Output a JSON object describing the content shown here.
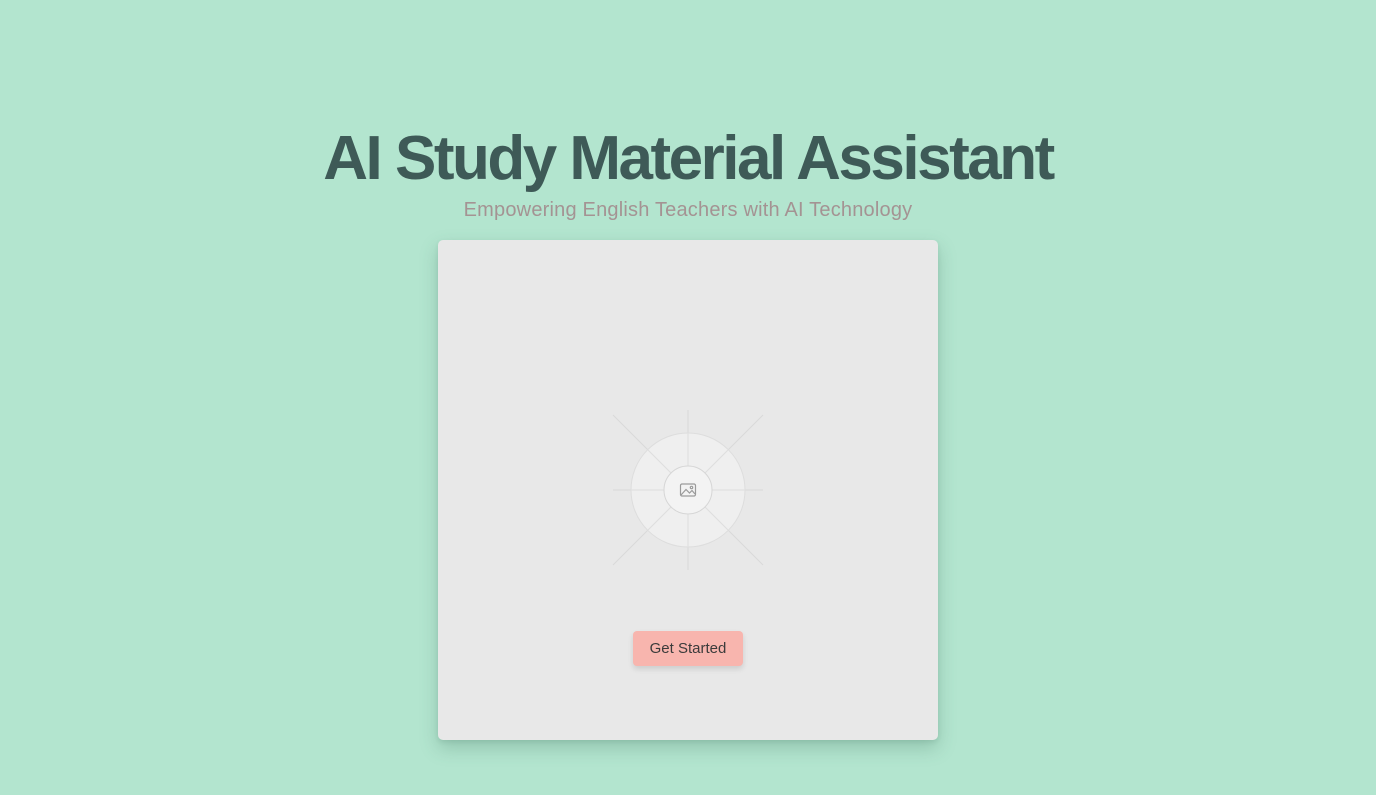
{
  "header": {
    "title": "AI Study Material Assistant",
    "subtitle": "Empowering English Teachers with AI Technology"
  },
  "card": {
    "image": "image-placeholder-icon",
    "cta_label": "Get Started"
  },
  "colors": {
    "background": "#b3e5cf",
    "title": "#3e5a57",
    "subtitle": "#a49393",
    "card": "#e8e8e8",
    "button": "#f8b5ae"
  }
}
